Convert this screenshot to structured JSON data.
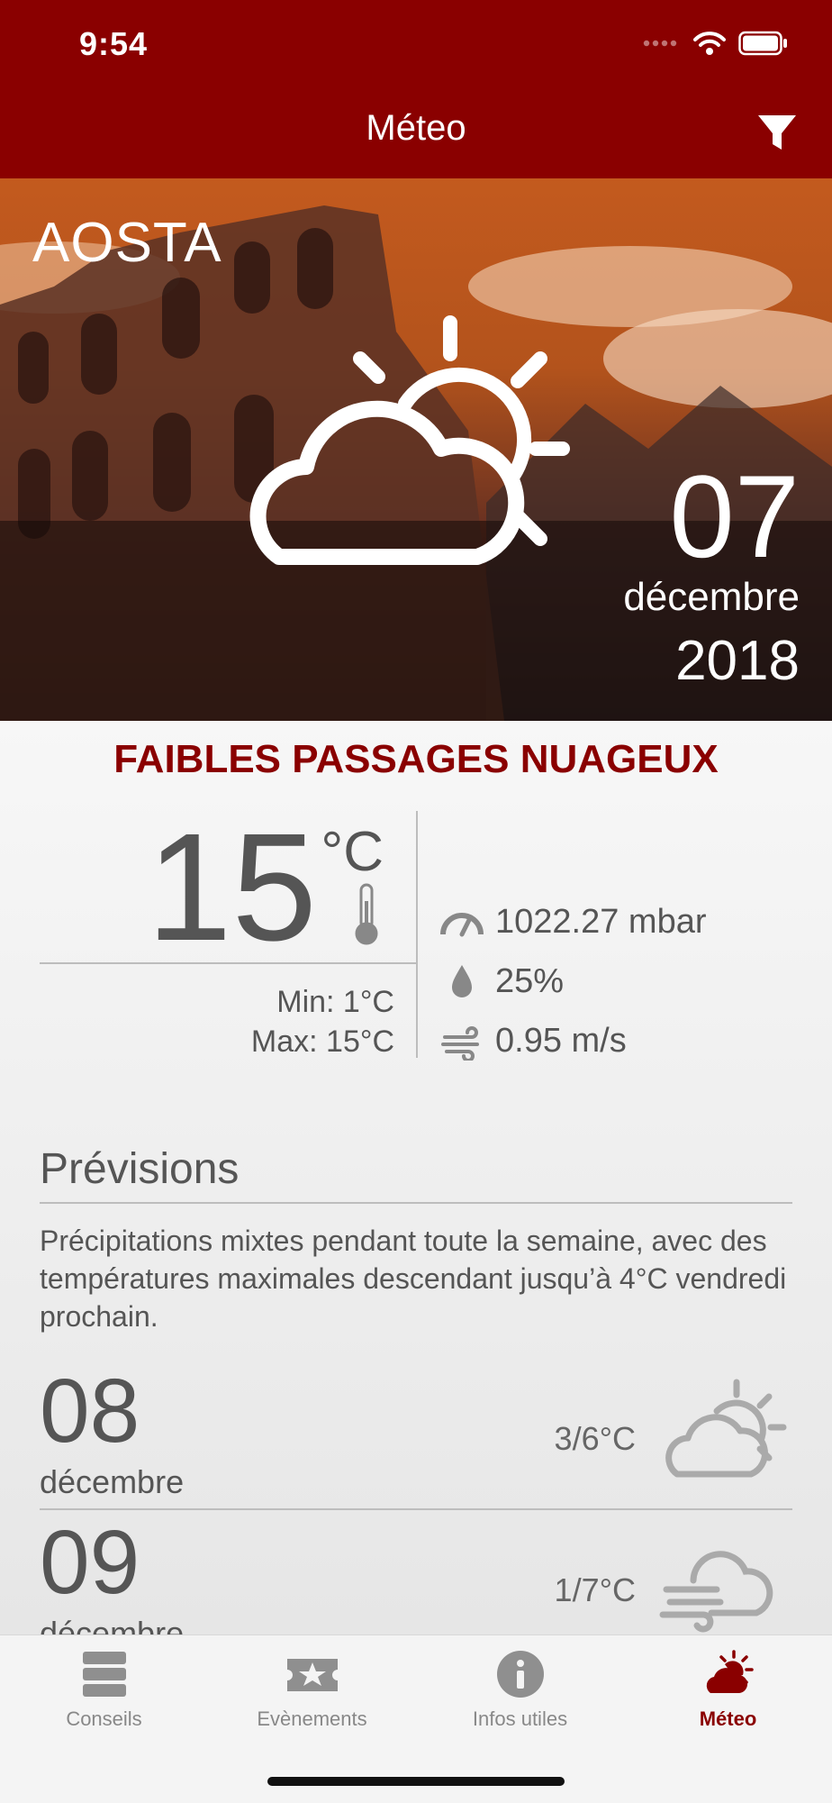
{
  "status": {
    "time": "9:54"
  },
  "nav": {
    "title": "Méteo",
    "filter_icon": "filter-icon"
  },
  "hero": {
    "city": "AOSTA",
    "day": "07",
    "month": "décembre",
    "year": "2018",
    "weather_icon": "partly-cloudy-icon"
  },
  "current": {
    "condition": "FAIBLES PASSAGES NUAGEUX",
    "temp": "15",
    "unit": "°C",
    "min": "Min: 1°C",
    "max": "Max: 15°C",
    "pressure": "1022.27 mbar",
    "humidity": "25%",
    "wind": "0.95 m/s"
  },
  "forecast": {
    "title": "Prévisions",
    "text": "Précipitations mixtes pendant toute la semaine, avec des températures maximales descendant jusqu’à 4°C vendredi prochain.",
    "days": [
      {
        "day": "08",
        "month": "décembre",
        "temp": "3/6°C",
        "icon": "partly-cloudy-icon"
      },
      {
        "day": "09",
        "month": "décembre",
        "temp": "1/7°C",
        "icon": "windy-cloud-icon"
      }
    ]
  },
  "tabs": [
    {
      "label": "Conseils",
      "icon": "stack-icon"
    },
    {
      "label": "Evènements",
      "icon": "ticket-star-icon"
    },
    {
      "label": "Infos utiles",
      "icon": "info-icon"
    },
    {
      "label": "Méteo",
      "icon": "weather-icon",
      "active": true
    }
  ],
  "colors": {
    "brand": "#8a0000",
    "text": "#555555"
  }
}
